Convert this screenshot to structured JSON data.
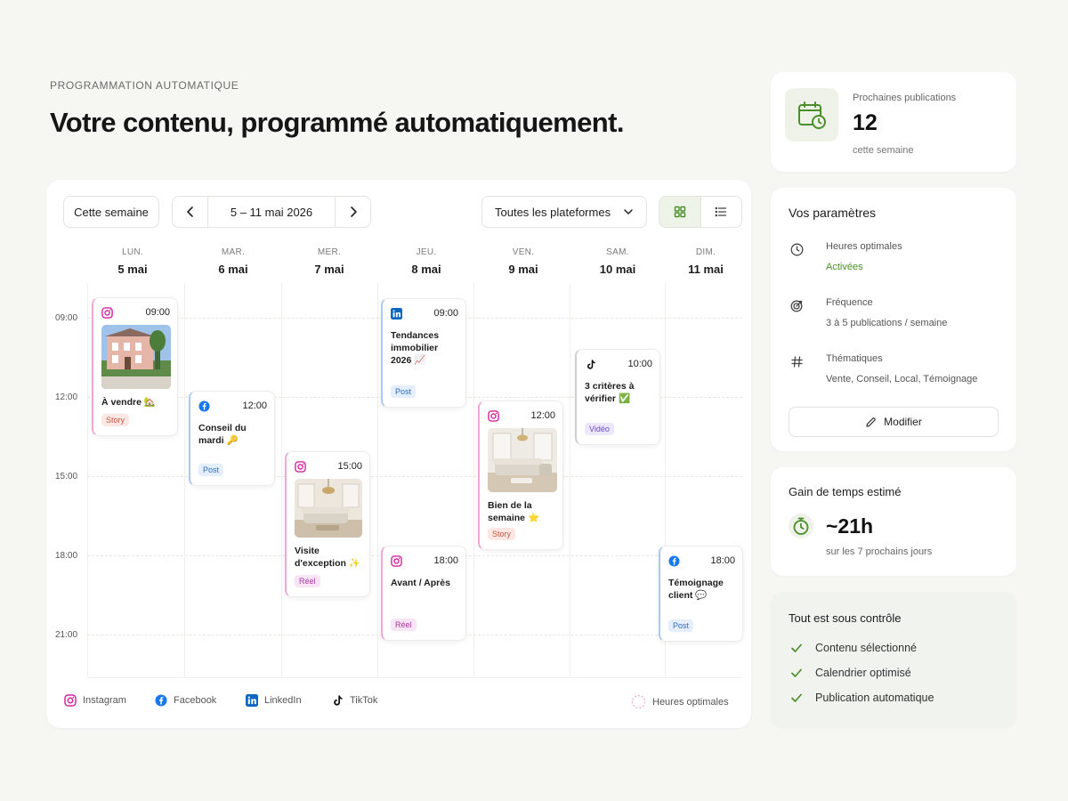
{
  "header": {
    "eyebrow": "PROGRAMMATION AUTOMATIQUE",
    "headline": "Votre contenu, programmé automatiquement."
  },
  "toolbar": {
    "this_week": "Cette semaine",
    "date_range": "5 – 11 mai 2026",
    "platform_filter": "Toutes les plateformes"
  },
  "days": [
    {
      "dow": "LUN.",
      "date": "5 mai"
    },
    {
      "dow": "MAR.",
      "date": "6 mai"
    },
    {
      "dow": "MER.",
      "date": "7 mai"
    },
    {
      "dow": "JEU.",
      "date": "8 mai"
    },
    {
      "dow": "VEN.",
      "date": "9 mai"
    },
    {
      "dow": "SAM.",
      "date": "10 mai"
    },
    {
      "dow": "DIM.",
      "date": "11 mai"
    }
  ],
  "times": [
    "09:00",
    "12:00",
    "15:00",
    "18:00",
    "21:00"
  ],
  "events": [
    {
      "platform": "instagram",
      "time": "09:00",
      "title": "À vendre 🏡",
      "tag": "Story"
    },
    {
      "platform": "facebook",
      "time": "12:00",
      "title": "Conseil du mardi 🔑",
      "tag": "Post"
    },
    {
      "platform": "instagram",
      "time": "15:00",
      "title": "Visite d'exception ✨",
      "tag": "Réel"
    },
    {
      "platform": "linkedin",
      "time": "09:00",
      "title": "Tendances immobilier 2026 📈",
      "tag": "Post"
    },
    {
      "platform": "instagram",
      "time": "18:00",
      "title": "Avant / Après",
      "tag": "Réel"
    },
    {
      "platform": "instagram",
      "time": "12:00",
      "title": "Bien de la semaine ⭐",
      "tag": "Story"
    },
    {
      "platform": "tiktok",
      "time": "10:00",
      "title": "3 critères à vérifier ✅",
      "tag": "Vidéo"
    },
    {
      "platform": "facebook",
      "time": "18:00",
      "title": "Témoignage client 💬",
      "tag": "Post"
    }
  ],
  "legend": {
    "instagram": "Instagram",
    "facebook": "Facebook",
    "linkedin": "LinkedIn",
    "tiktok": "TikTok",
    "optimal": "Heures optimales"
  },
  "upcoming": {
    "label": "Prochaines publications",
    "count": "12",
    "sub": "cette semaine"
  },
  "settings": {
    "title": "Vos paramètres",
    "items": [
      {
        "label": "Heures optimales",
        "value": "Activées",
        "icon": "clock-icon"
      },
      {
        "label": "Fréquence",
        "value": "3 à 5 publications / semaine",
        "icon": "target-icon"
      },
      {
        "label": "Thématiques",
        "value": "Vente, Conseil, Local, Témoignage",
        "icon": "hashtag-icon"
      }
    ],
    "modify": "Modifier"
  },
  "time_saved": {
    "title": "Gain de temps estimé",
    "value": "~21h",
    "sub": "sur les 7 prochains jours"
  },
  "control": {
    "title": "Tout est sous contrôle",
    "items": [
      "Contenu sélectionné",
      "Calendrier optimisé",
      "Publication automatique"
    ]
  },
  "colors": {
    "accent_green": "#4a8f2a",
    "background": "#f6f6f3"
  }
}
